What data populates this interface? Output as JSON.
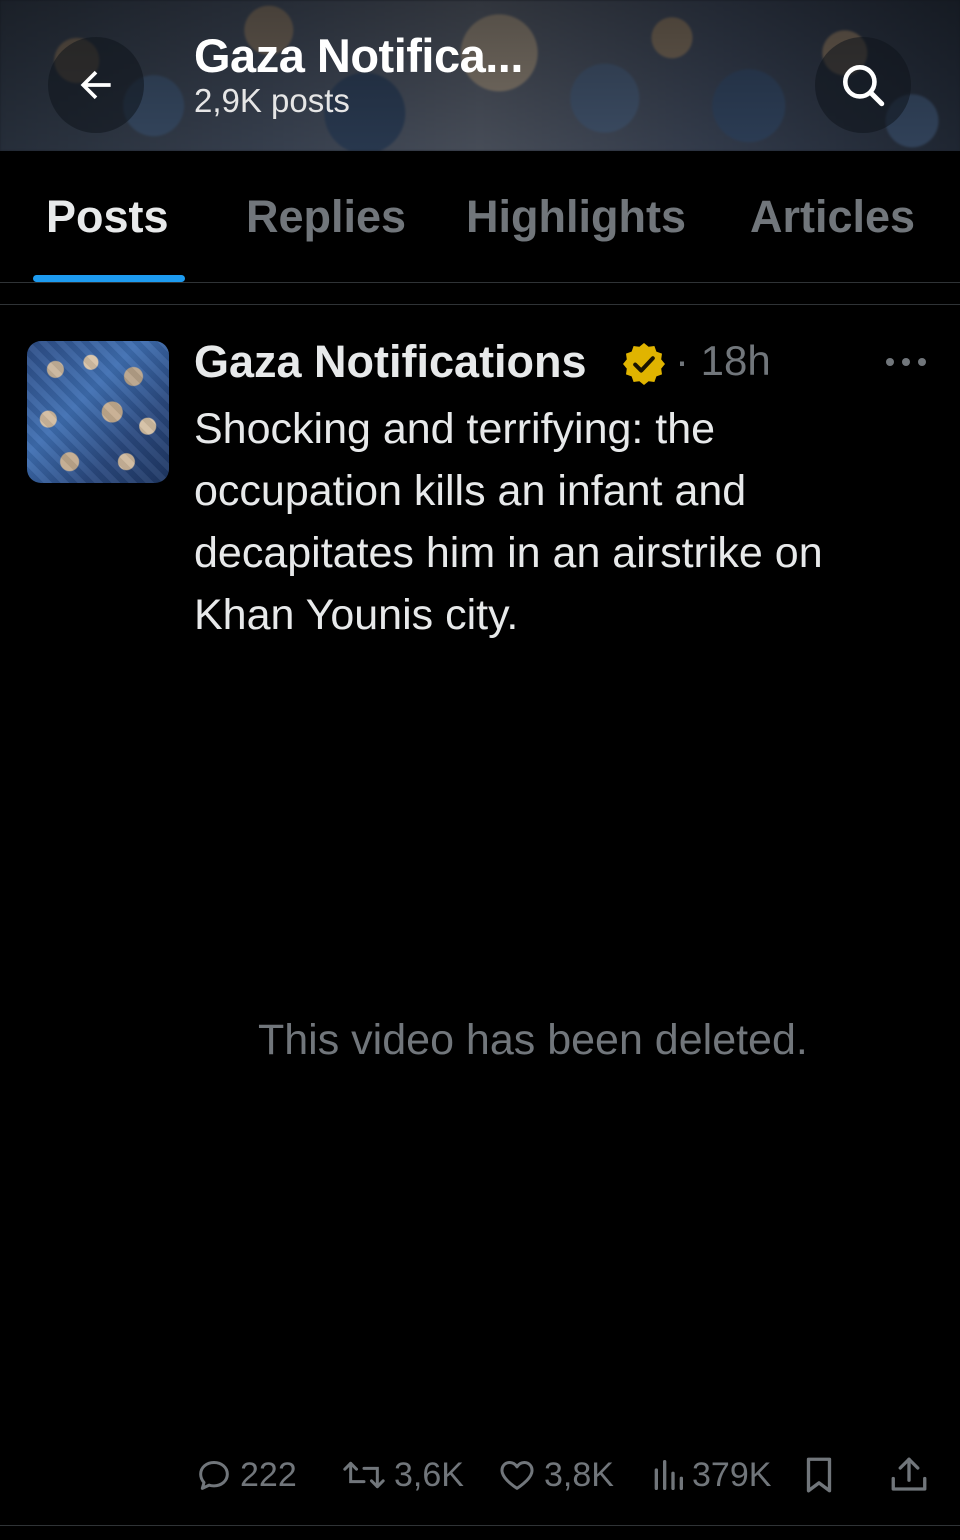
{
  "header": {
    "title": "Gaza Notifica...",
    "post_count": "2,9K posts"
  },
  "tabs": [
    {
      "label": "Posts",
      "active": true
    },
    {
      "label": "Replies",
      "active": false
    },
    {
      "label": "Highlights",
      "active": false
    },
    {
      "label": "Articles",
      "active": false
    }
  ],
  "post": {
    "author": "Gaza Notifications",
    "separator": "·",
    "time": "18h",
    "text": "Shocking and terrifying: the occupation kills an infant and decapitates him in an airstrike on Khan Younis city.",
    "media_message": "This video has been deleted.",
    "actions": {
      "replies": "222",
      "reposts": "3,6K",
      "likes": "3,8K",
      "views": "379K"
    }
  },
  "icons": {
    "back": "arrow-left-icon",
    "search": "search-icon",
    "verified": "verified-badge-icon",
    "more": "more-horizontal-icon",
    "reply": "reply-icon",
    "repost": "repost-icon",
    "like": "heart-icon",
    "views": "views-icon",
    "bookmark": "bookmark-icon",
    "share": "share-icon"
  },
  "colors": {
    "accent": "#1d9bf0",
    "verified": "#e0b400",
    "muted": "#71767b",
    "text": "#e7e9ea",
    "background": "#000000"
  }
}
